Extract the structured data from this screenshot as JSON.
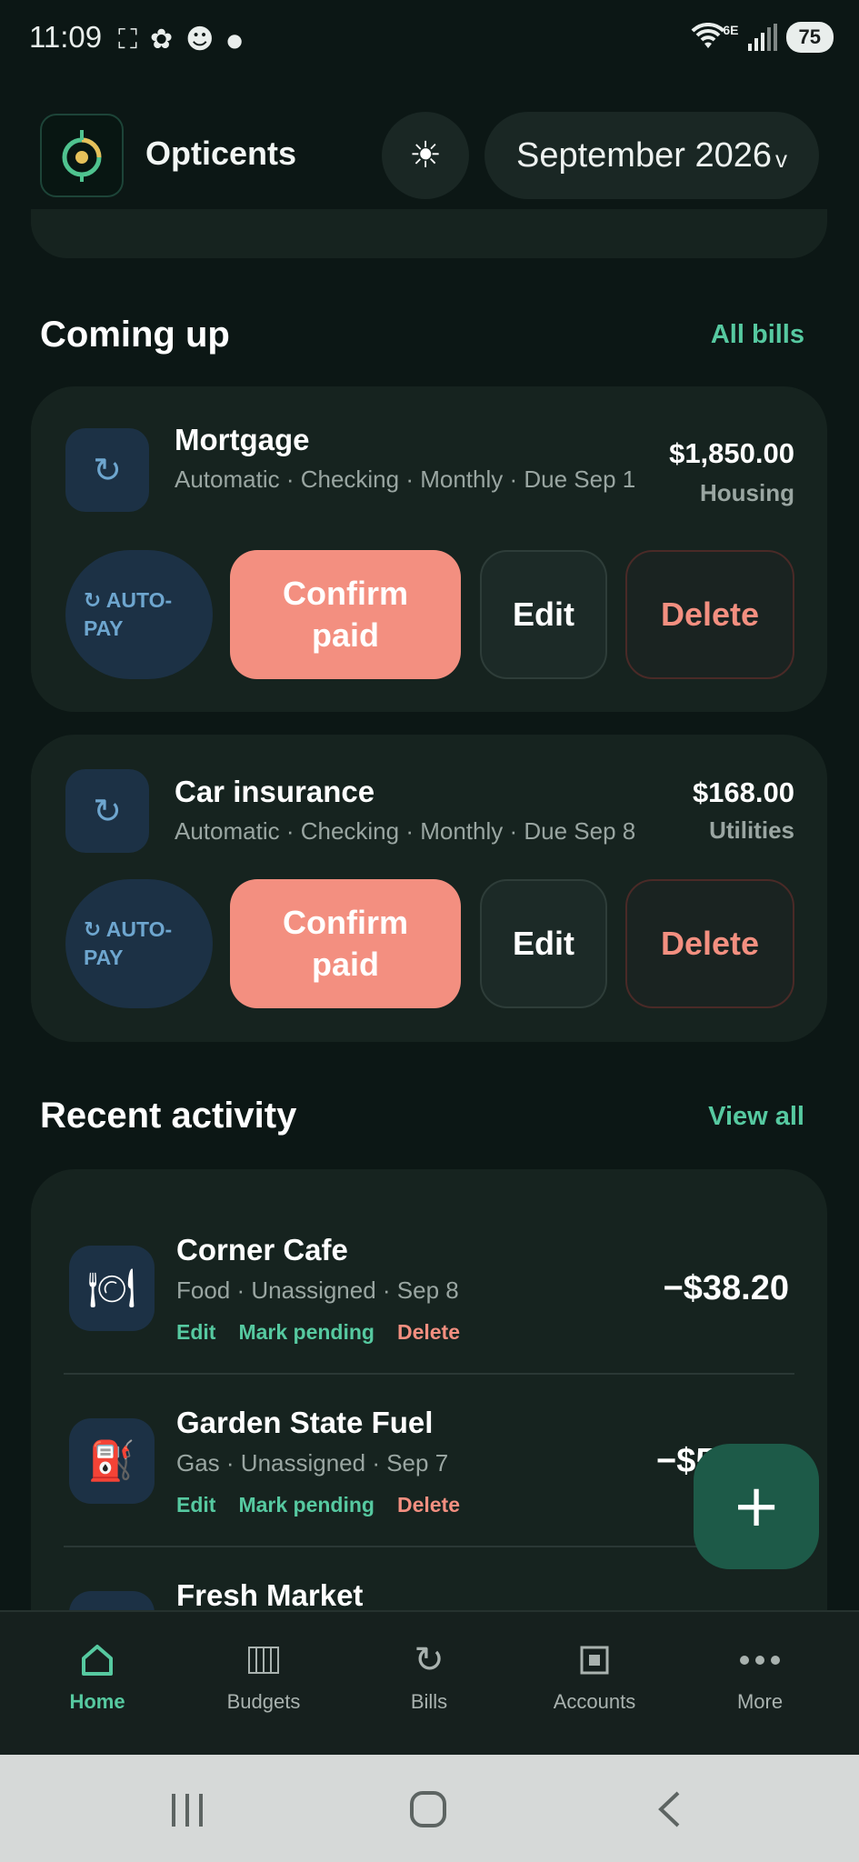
{
  "status_bar": {
    "time": "11:09",
    "left_icons": [
      "screenshot-icon",
      "chatgpt-icon",
      "reddit-icon",
      "dot-icon"
    ],
    "network": "6E",
    "battery": "75"
  },
  "header": {
    "app_name": "Opticents",
    "month": "September 2026",
    "month_chevron": "v",
    "theme_icon": "sun-icon"
  },
  "coming_up": {
    "title": "Coming up",
    "link": "All bills",
    "bills": [
      {
        "name": "Mortgage",
        "meta": "Automatic · Checking · Monthly · Due Sep 1",
        "amount": "$1,850.00",
        "category": "Housing",
        "icon": "repeat-icon",
        "autopay_line1": "↻ AUTO-",
        "autopay_line2": "PAY",
        "confirm_line1": "Confirm",
        "confirm_line2": "paid",
        "edit": "Edit",
        "delete": "Delete"
      },
      {
        "name": "Car insurance",
        "meta": "Automatic · Checking · Monthly · Due Sep 8",
        "amount": "$168.00",
        "category": "Utilities",
        "icon": "repeat-icon",
        "autopay_line1": "↻ AUTO-",
        "autopay_line2": "PAY",
        "confirm_line1": "Confirm",
        "confirm_line2": "paid",
        "edit": "Edit",
        "delete": "Delete"
      }
    ]
  },
  "recent_activity": {
    "title": "Recent activity",
    "link": "View all",
    "transactions": [
      {
        "name": "Corner Cafe",
        "meta": "Food · Unassigned · Sep 8",
        "amount": "−$38.20",
        "icon": "plate-icon",
        "edit": "Edit",
        "pending": "Mark pending",
        "delete": "Delete"
      },
      {
        "name": "Garden State Fuel",
        "meta": "Gas · Unassigned · Sep 7",
        "amount": "−$5",
        "icon": "fuel-pump-icon",
        "edit": "Edit",
        "pending": "Mark pending",
        "delete": "Delete"
      },
      {
        "name": "Fresh Market"
      }
    ]
  },
  "fab": {
    "label": "+"
  },
  "bottom_nav": {
    "items": [
      {
        "label": "Home",
        "icon": "home-icon",
        "active": true
      },
      {
        "label": "Budgets",
        "icon": "budgets-icon",
        "active": false
      },
      {
        "label": "Bills",
        "icon": "repeat-icon",
        "active": false
      },
      {
        "label": "Accounts",
        "icon": "accounts-icon",
        "active": false
      },
      {
        "label": "More",
        "icon": "more-icon",
        "active": false
      }
    ]
  },
  "colors": {
    "background": "#0c1715",
    "card": "#16231f",
    "accent": "#56c9a0",
    "danger": "#f38f80",
    "icon_bg": "#1c3145"
  }
}
